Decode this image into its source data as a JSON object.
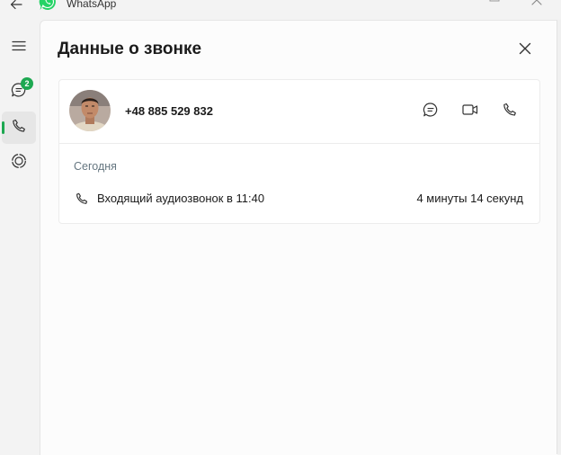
{
  "app": {
    "title": "WhatsApp"
  },
  "sidebar": {
    "chats_badge": "2"
  },
  "panel": {
    "title": "Данные о звонке"
  },
  "contact": {
    "phone": "+48 885 529 832"
  },
  "calls": {
    "day_label": "Сегодня",
    "items": [
      {
        "description": "Входящий аудиозвонок в 11:40",
        "duration": "4 минуты 14 секунд"
      }
    ]
  },
  "colors": {
    "accent": "#1da851",
    "panel_bg": "#fcfcfc",
    "window_bg": "#f3f3f3"
  },
  "icons": {
    "back": "back-arrow-icon",
    "logo": "whatsapp-logo-icon",
    "maximize": "maximize-icon",
    "close": "close-icon",
    "menu": "hamburger-menu-icon",
    "chats": "chat-bubble-icon",
    "calls": "phone-icon",
    "status": "status-ring-icon",
    "message": "message-icon",
    "video": "video-camera-icon",
    "audio": "phone-icon"
  }
}
